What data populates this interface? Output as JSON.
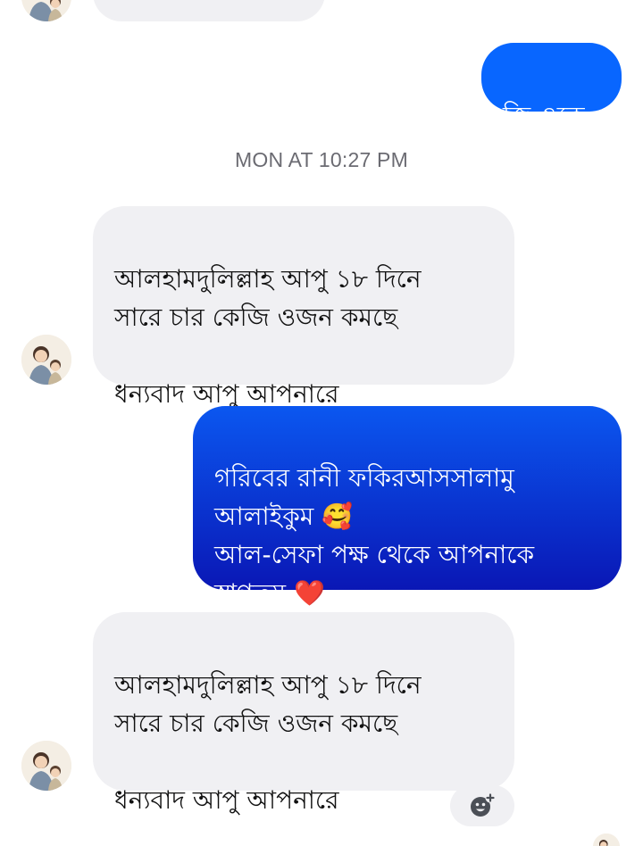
{
  "conversation": {
    "messages": [
      {
        "from": "them",
        "text": ""
      },
      {
        "from": "me",
        "text": "জ্বি ওকে"
      },
      {
        "type": "timestamp",
        "text": "MON AT 10:27 PM"
      },
      {
        "from": "them",
        "text": "আলহামদুলিল্লাহ আপু ১৮ দিনে\nসারে চার কেজি  ওজন কমছে\n\nধন্যবাদ আপু আপনারে"
      },
      {
        "from": "me",
        "text": "গরিবের রানী ফকিরআসসালামু\nআলাইকুম 🥰\nআল-সেফা পক্ষ থেকে আপনাকে\nস্বাগতম ❤️"
      },
      {
        "from": "them",
        "text": "আলহামদুলিল্লাহ আপু ১৮ দিনে\nসারে চার কেজি ওজন কমছে\n\nধন্যবাদ আপু আপনারে"
      }
    ]
  },
  "icons": {
    "avatar": "avatar-icon",
    "add_reaction": "add-reaction-icon"
  },
  "colors": {
    "incoming_bubble": "#f0f0f3",
    "outgoing_solid": "#0866ff",
    "outgoing_gradient_top": "#0b57f0",
    "outgoing_gradient_bottom": "#0a17b5",
    "timestamp_text": "#6b6b72"
  }
}
